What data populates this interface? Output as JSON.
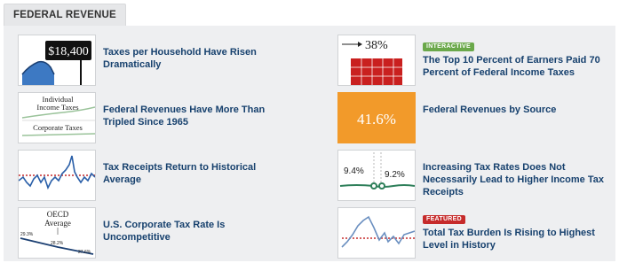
{
  "tab": {
    "label": "FEDERAL REVENUE"
  },
  "items": [
    {
      "title": "Taxes per Household Have Risen Dramatically",
      "thumb_text": "$18,400"
    },
    {
      "title": "Federal Revenues Have More Than Tripled Since 1965",
      "thumb_text": [
        "Individual",
        "Income Taxes",
        "Corporate Taxes"
      ]
    },
    {
      "title": "Tax Receipts Return to Historical Average"
    },
    {
      "title": "U.S. Corporate Tax Rate Is Uncompetitive",
      "thumb_text": [
        "OECD",
        "Average",
        "29.3%",
        "28.2%",
        "27.6%"
      ]
    },
    {
      "title": "The Top 10 Percent of Earners Paid 70 Percent of Federal Income Taxes",
      "badge": "INTERACTIVE",
      "thumb_text": "38%"
    },
    {
      "title": "Federal Revenues by Source",
      "thumb_text": "41.6%"
    },
    {
      "title": "Increasing Tax Rates Does Not Necessarily Lead to Higher Income Tax Receipts",
      "thumb_text": [
        "9.4%",
        "9.2%"
      ]
    },
    {
      "title": "Total Tax Burden Is Rising to Highest Level in History",
      "badge": "FEATURED"
    }
  ],
  "colors": {
    "title_link": "#17416e",
    "badge_interactive": "#6aa84a",
    "badge_featured": "#c62b2b",
    "chart_blue": "#2a5fa8",
    "chart_red": "#c62b2b",
    "orange": "#f29a2a",
    "green": "#2e7f5a"
  }
}
